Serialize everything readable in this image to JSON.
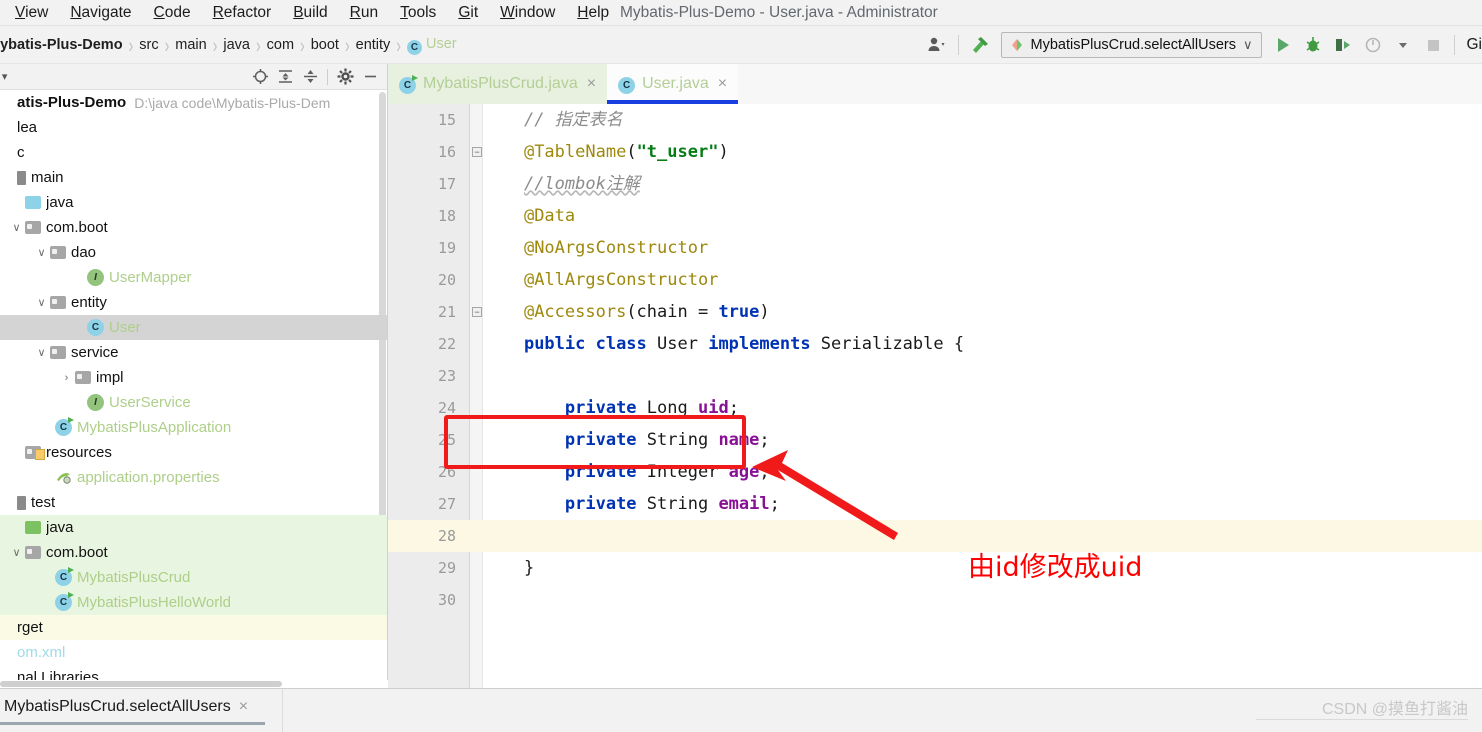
{
  "window": {
    "title": "Mybatis-Plus-Demo - User.java - Administrator"
  },
  "menubar": {
    "items": [
      {
        "label": "View",
        "mnemonic": "V"
      },
      {
        "label": "Navigate",
        "mnemonic": "N"
      },
      {
        "label": "Code",
        "mnemonic": "C"
      },
      {
        "label": "Refactor",
        "mnemonic": "R"
      },
      {
        "label": "Build",
        "mnemonic": "B"
      },
      {
        "label": "Run",
        "mnemonic": "R"
      },
      {
        "label": "Tools",
        "mnemonic": "T"
      },
      {
        "label": "Git",
        "mnemonic": "G"
      },
      {
        "label": "Window",
        "mnemonic": "W"
      },
      {
        "label": "Help",
        "mnemonic": "H"
      }
    ]
  },
  "breadcrumb": {
    "items": [
      "Mybatis-Plus-Demo",
      "src",
      "main",
      "java",
      "com",
      "boot",
      "entity"
    ],
    "leaf": "User",
    "leaf_icon_letter": "C"
  },
  "toolbar": {
    "run_config": "MybatisPlusCrud.selectAllUsers",
    "run_config_chevron": "∨",
    "git_label": "Gi",
    "icons": [
      "user-settings-icon",
      "build-hammer-icon",
      "run-icon",
      "debug-icon",
      "run-with-coverage-icon",
      "profiler-icon",
      "stop-icon"
    ]
  },
  "project_panel": {
    "title_chevron": "▾",
    "toolbar_icons": [
      "locate-icon",
      "expand-all-icon",
      "collapse-all-icon",
      "settings-gear-icon",
      "hide-panel-icon"
    ],
    "tree": [
      {
        "label": "atis-Plus-Demo",
        "full": "Mybatis-Plus-Demo",
        "hint": "D:\\java code\\Mybatis-Plus-Dem",
        "indent": -18,
        "icon": "none",
        "style": "bold",
        "chevron": "",
        "bg": "none"
      },
      {
        "label": "lea",
        "full": ".idea",
        "indent": -18,
        "icon": "none",
        "style": "plain",
        "chevron": "",
        "bg": "none"
      },
      {
        "label": "c",
        "full": "src",
        "indent": -18,
        "icon": "none",
        "style": "plain",
        "chevron": "",
        "bg": "none"
      },
      {
        "label": "main",
        "full": "main",
        "indent": -8,
        "icon": "module",
        "style": "plain",
        "chevron": "",
        "bg": "none"
      },
      {
        "label": "java",
        "full": "java",
        "indent": 8,
        "icon": "folder-blue",
        "style": "plain",
        "chevron": "",
        "bg": "none"
      },
      {
        "label": "com.boot",
        "full": "com.boot",
        "indent": 8,
        "icon": "folder-pkg",
        "style": "plain",
        "chevron": "∨",
        "bg": "none"
      },
      {
        "label": "dao",
        "full": "dao",
        "indent": 33,
        "icon": "folder-pkg",
        "style": "plain",
        "chevron": "∨",
        "bg": "none"
      },
      {
        "label": "UserMapper",
        "full": "UserMapper",
        "indent": 70,
        "icon": "interface",
        "style": "green",
        "chevron": "",
        "bg": "none"
      },
      {
        "label": "entity",
        "full": "entity",
        "indent": 33,
        "icon": "folder-pkg",
        "style": "plain",
        "chevron": "∨",
        "bg": "none"
      },
      {
        "label": "User",
        "full": "User",
        "indent": 70,
        "icon": "class",
        "style": "green",
        "chevron": "",
        "bg": "selected"
      },
      {
        "label": "service",
        "full": "service",
        "indent": 33,
        "icon": "folder-pkg",
        "style": "plain",
        "chevron": "∨",
        "bg": "none"
      },
      {
        "label": "impl",
        "full": "impl",
        "indent": 58,
        "icon": "folder-pkg",
        "style": "plain",
        "chevron": "›",
        "bg": "none"
      },
      {
        "label": "UserService",
        "full": "UserService",
        "indent": 70,
        "icon": "interface",
        "style": "green",
        "chevron": "",
        "bg": "none"
      },
      {
        "label": "MybatisPlusApplication",
        "full": "MybatisPlusApplication",
        "indent": 38,
        "icon": "class-run",
        "style": "green",
        "chevron": "",
        "bg": "none"
      },
      {
        "label": "resources",
        "full": "resources",
        "indent": 8,
        "icon": "folder-res",
        "style": "plain",
        "chevron": "",
        "bg": "none"
      },
      {
        "label": "application.properties",
        "full": "application.properties",
        "indent": 38,
        "icon": "properties",
        "style": "green",
        "chevron": "",
        "bg": "none"
      },
      {
        "label": "test",
        "full": "test",
        "indent": -8,
        "icon": "module",
        "style": "plain",
        "chevron": "",
        "bg": "none"
      },
      {
        "label": "java",
        "full": "java",
        "indent": 8,
        "icon": "folder-green",
        "style": "plain",
        "chevron": "",
        "bg": "green"
      },
      {
        "label": "com.boot",
        "full": "com.boot",
        "indent": 8,
        "icon": "folder-pkg",
        "style": "plain",
        "chevron": "∨",
        "bg": "green"
      },
      {
        "label": "MybatisPlusCrud",
        "full": "MybatisPlusCrud",
        "indent": 38,
        "icon": "class-test",
        "style": "green",
        "chevron": "",
        "bg": "green"
      },
      {
        "label": "MybatisPlusHelloWorld",
        "full": "MybatisPlusHelloWorld",
        "indent": 38,
        "icon": "class-test",
        "style": "green",
        "chevron": "",
        "bg": "green"
      },
      {
        "label": "rget",
        "full": "target",
        "indent": -18,
        "icon": "none",
        "style": "plain",
        "chevron": "",
        "bg": "yellow"
      },
      {
        "label": "om.xml",
        "full": "pom.xml",
        "indent": -18,
        "icon": "none",
        "style": "cyan",
        "chevron": "",
        "bg": "none"
      },
      {
        "label": "nal Libraries",
        "full": "External Libraries",
        "indent": -18,
        "icon": "none",
        "style": "plain",
        "chevron": "",
        "bg": "none"
      }
    ]
  },
  "editor": {
    "tabs": [
      {
        "label": "MybatisPlusCrud.java",
        "icon": "class-test-icon",
        "active": false,
        "close": "×"
      },
      {
        "label": "User.java",
        "icon": "class-icon",
        "active": true,
        "close": "×"
      }
    ],
    "code_lines": [
      {
        "num": "15",
        "fold": "",
        "highlight": false,
        "tokens": [
          {
            "t": "    ",
            "c": "ty"
          },
          {
            "t": "// 指定表名",
            "c": "cm"
          }
        ]
      },
      {
        "num": "16",
        "fold": "−",
        "highlight": false,
        "tokens": [
          {
            "t": "    ",
            "c": "ty"
          },
          {
            "t": "@TableName",
            "c": "ann"
          },
          {
            "t": "(",
            "c": "ty"
          },
          {
            "t": "\"t_user\"",
            "c": "str"
          },
          {
            "t": ")",
            "c": "ty"
          }
        ]
      },
      {
        "num": "17",
        "fold": "",
        "highlight": false,
        "tokens": [
          {
            "t": "    ",
            "c": "ty"
          },
          {
            "t": "//lombok注解",
            "c": "cmsquig"
          }
        ]
      },
      {
        "num": "18",
        "fold": "",
        "highlight": false,
        "tokens": [
          {
            "t": "    ",
            "c": "ty"
          },
          {
            "t": "@Data",
            "c": "ann"
          }
        ]
      },
      {
        "num": "19",
        "fold": "",
        "highlight": false,
        "tokens": [
          {
            "t": "    ",
            "c": "ty"
          },
          {
            "t": "@NoArgsConstructor",
            "c": "ann"
          }
        ]
      },
      {
        "num": "20",
        "fold": "",
        "highlight": false,
        "tokens": [
          {
            "t": "    ",
            "c": "ty"
          },
          {
            "t": "@AllArgsConstructor",
            "c": "ann"
          }
        ]
      },
      {
        "num": "21",
        "fold": "−",
        "highlight": false,
        "tokens": [
          {
            "t": "    ",
            "c": "ty"
          },
          {
            "t": "@Accessors",
            "c": "ann"
          },
          {
            "t": "(chain = ",
            "c": "ty"
          },
          {
            "t": "true",
            "c": "k"
          },
          {
            "t": ")",
            "c": "ty"
          }
        ]
      },
      {
        "num": "22",
        "fold": "",
        "highlight": false,
        "tokens": [
          {
            "t": "    ",
            "c": "ty"
          },
          {
            "t": "public class ",
            "c": "k"
          },
          {
            "t": "User ",
            "c": "ty"
          },
          {
            "t": "implements ",
            "c": "k"
          },
          {
            "t": "Serializable {",
            "c": "ty"
          }
        ]
      },
      {
        "num": "23",
        "fold": "",
        "highlight": false,
        "tokens": []
      },
      {
        "num": "24",
        "fold": "",
        "highlight": false,
        "tokens": [
          {
            "t": "        ",
            "c": "ty"
          },
          {
            "t": "private ",
            "c": "k"
          },
          {
            "t": "Long ",
            "c": "ty"
          },
          {
            "t": "uid",
            "c": "fld"
          },
          {
            "t": ";",
            "c": "ty"
          }
        ]
      },
      {
        "num": "25",
        "fold": "",
        "highlight": false,
        "tokens": [
          {
            "t": "        ",
            "c": "ty"
          },
          {
            "t": "private ",
            "c": "k"
          },
          {
            "t": "String ",
            "c": "ty"
          },
          {
            "t": "name",
            "c": "fld"
          },
          {
            "t": ";",
            "c": "ty"
          }
        ]
      },
      {
        "num": "26",
        "fold": "",
        "highlight": false,
        "tokens": [
          {
            "t": "        ",
            "c": "ty"
          },
          {
            "t": "private ",
            "c": "k"
          },
          {
            "t": "Integer ",
            "c": "ty"
          },
          {
            "t": "age",
            "c": "fld"
          },
          {
            "t": ";",
            "c": "ty"
          }
        ]
      },
      {
        "num": "27",
        "fold": "",
        "highlight": false,
        "tokens": [
          {
            "t": "        ",
            "c": "ty"
          },
          {
            "t": "private ",
            "c": "k"
          },
          {
            "t": "String ",
            "c": "ty"
          },
          {
            "t": "email",
            "c": "fld"
          },
          {
            "t": ";",
            "c": "ty"
          }
        ]
      },
      {
        "num": "28",
        "fold": "",
        "highlight": true,
        "tokens": []
      },
      {
        "num": "29",
        "fold": "",
        "highlight": false,
        "tokens": [
          {
            "t": "    }",
            "c": "ty"
          }
        ]
      },
      {
        "num": "30",
        "fold": "",
        "highlight": false,
        "tokens": []
      }
    ]
  },
  "annotations": {
    "highlight_box_target": "private Long uid;",
    "note_text": "由id修改成uid",
    "color": "#ff0000"
  },
  "bottom": {
    "run_tab_label": "MybatisPlusCrud.selectAllUsers",
    "run_tab_close": "×",
    "watermark": "CSDN @摸鱼打酱油"
  }
}
